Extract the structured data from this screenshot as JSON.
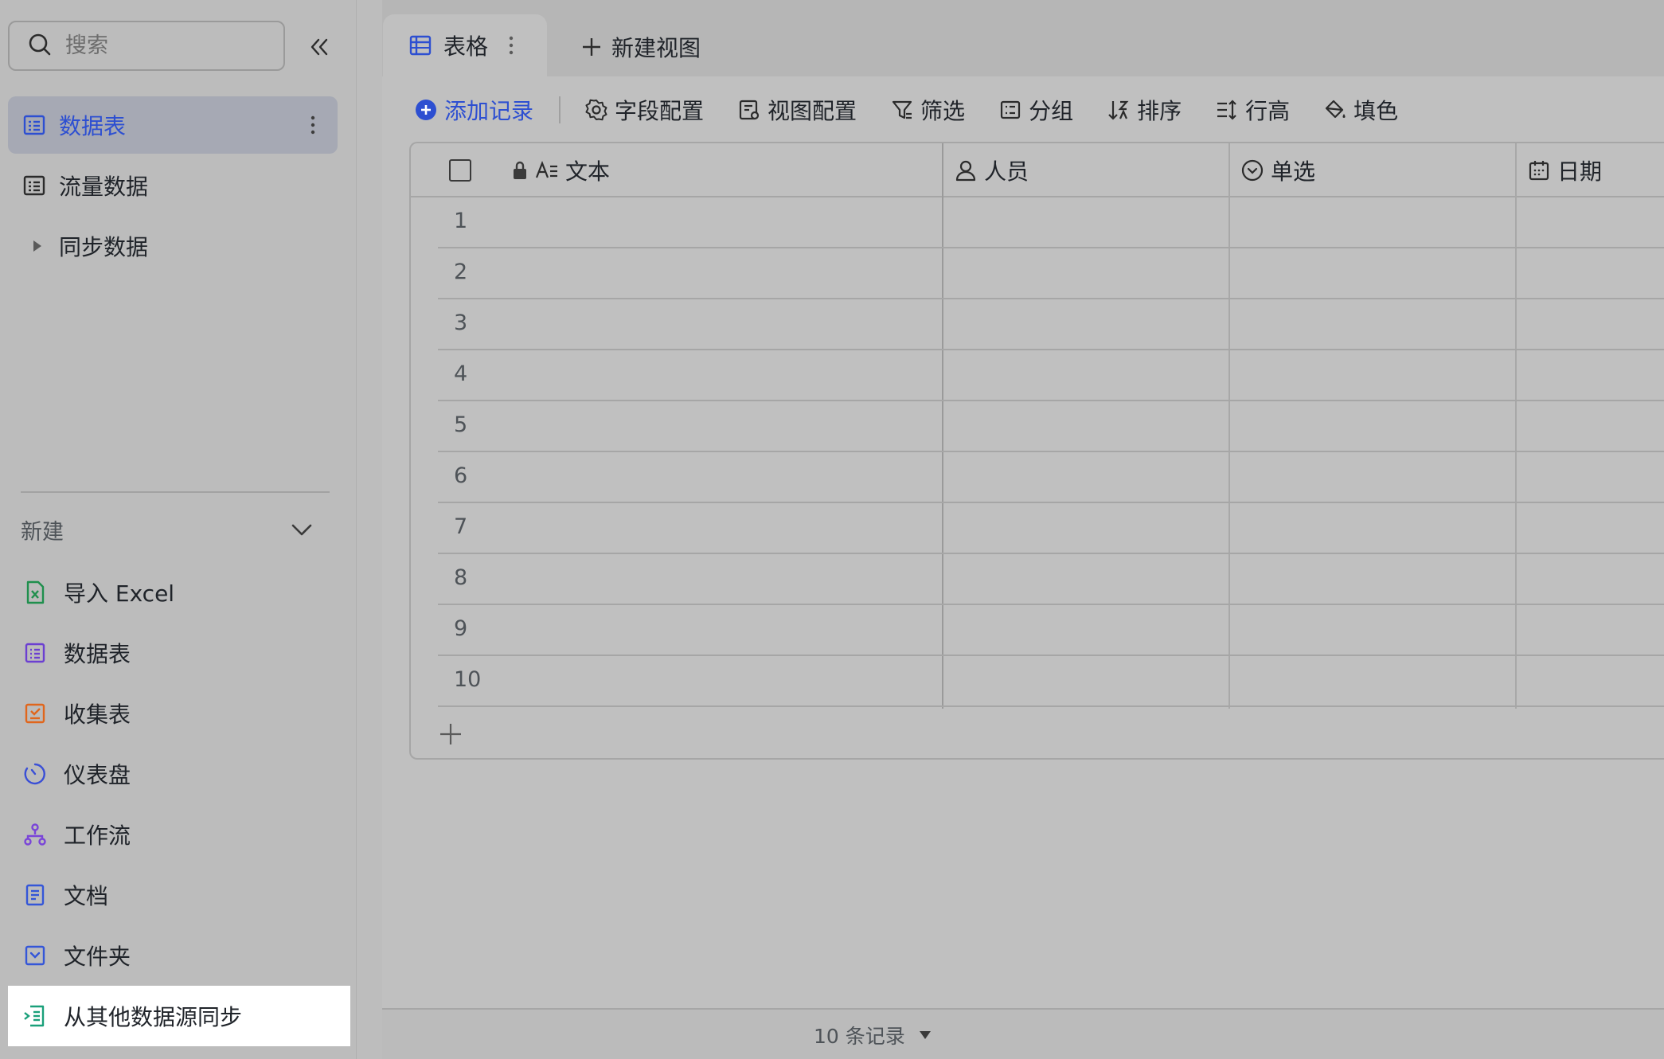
{
  "sidebar": {
    "search_placeholder": "搜索",
    "tables": [
      {
        "label": "数据表",
        "active": true
      },
      {
        "label": "流量数据",
        "active": false
      },
      {
        "label": "同步数据",
        "active": false
      }
    ],
    "new_section": {
      "title": "新建",
      "items": [
        {
          "label": "导入 Excel",
          "icon": "excel-icon",
          "color": "#1f8f4d"
        },
        {
          "label": "数据表",
          "icon": "datatable-icon",
          "color": "#6b3fd1"
        },
        {
          "label": "收集表",
          "icon": "form-icon",
          "color": "#e0661c"
        },
        {
          "label": "仪表盘",
          "icon": "dashboard-icon",
          "color": "#3a4fd6"
        },
        {
          "label": "工作流",
          "icon": "workflow-icon",
          "color": "#7a45d8"
        },
        {
          "label": "文档",
          "icon": "doc-icon",
          "color": "#3456d8"
        },
        {
          "label": "文件夹",
          "icon": "folder-icon",
          "color": "#3456d8"
        },
        {
          "label": "从其他数据源同步",
          "icon": "sync-source-icon",
          "color": "#1aa07a"
        }
      ]
    }
  },
  "main": {
    "tabs": [
      {
        "label": "表格"
      }
    ],
    "new_view_label": "新建视图",
    "toolbar": {
      "add_record": "添加记录",
      "field_config": "字段配置",
      "view_config": "视图配置",
      "filter": "筛选",
      "group": "分组",
      "sort": "排序",
      "row_height": "行高",
      "fill_color": "填色"
    },
    "columns": [
      {
        "label": "文本",
        "icon": "text-field-icon"
      },
      {
        "label": "人员",
        "icon": "person-icon"
      },
      {
        "label": "单选",
        "icon": "single-select-icon"
      },
      {
        "label": "日期",
        "icon": "calendar-icon"
      }
    ],
    "rows": [
      "1",
      "2",
      "3",
      "4",
      "5",
      "6",
      "7",
      "8",
      "9",
      "10"
    ],
    "record_count": "10 条记录"
  },
  "colors": {
    "accent": "#2d4fd1",
    "active_item_bg": "#a6a9b4",
    "highlight_bg": "#ffffff"
  }
}
